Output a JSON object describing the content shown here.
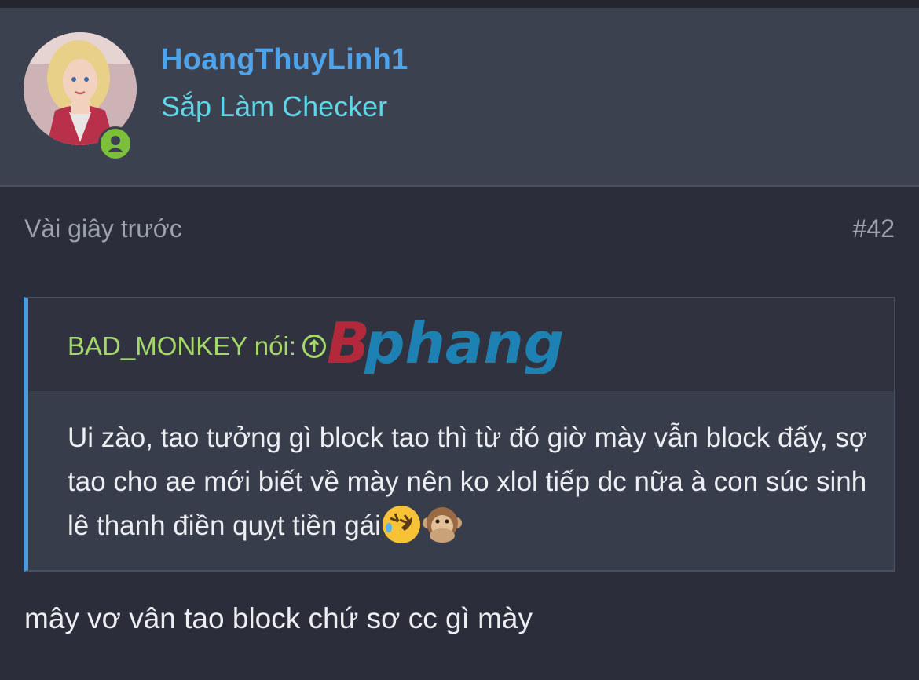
{
  "user": {
    "name": "HoangThuyLinh1",
    "title": "Sắp Làm Checker"
  },
  "post": {
    "time": "Vài giây trước",
    "number": "#42",
    "quote": {
      "author": "BAD_MONKEY nói:",
      "watermark": "Bphang",
      "text": "Ui zào, tao tưởng gì block tao thì từ đó giờ mày vẫn block đấy, sợ tao cho ae mới biết về mày nên ko xlol tiếp dc nữa à con súc sinh lê thanh điền quỵt tiền gái",
      "emojis": [
        "rolling-on-floor-laughing-emoji",
        "speak-no-evil-monkey-emoji"
      ]
    },
    "reply": "mây vơ vân tao block chứ sơ cc gì mày"
  },
  "colors": {
    "background": "#2b2e3a",
    "header": "#3c4150",
    "username": "#4fa3ea",
    "usertitle": "#5fd6e8",
    "quote_author": "#a4d86a",
    "quote_bar": "#4b9cdb",
    "online": "#7cbf3a"
  }
}
